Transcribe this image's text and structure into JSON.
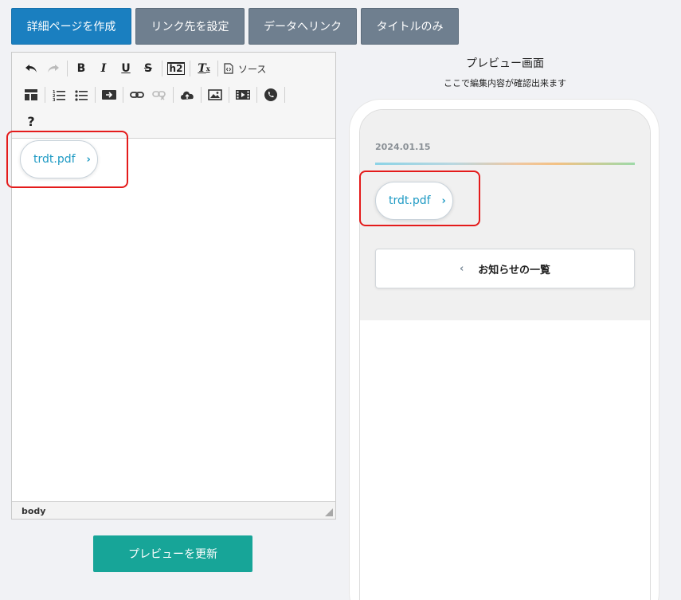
{
  "tabs": [
    {
      "label": "詳細ページを作成",
      "active": true
    },
    {
      "label": "リンク先を設定",
      "active": false
    },
    {
      "label": "データへリンク",
      "active": false
    },
    {
      "label": "タイトルのみ",
      "active": false
    }
  ],
  "editor": {
    "toolbar": {
      "row1": [
        "undo-icon",
        "redo-icon",
        "bold-icon",
        "italic-icon",
        "underline-icon",
        "strikethrough-icon",
        "heading-h2-icon",
        "remove-format-icon",
        "source-icon"
      ],
      "bold": "B",
      "italic": "I",
      "underline": "U",
      "strike": "S",
      "h2": "h2",
      "clear_format": "T",
      "source_label": "ソース",
      "help": "?"
    },
    "content": {
      "pdf_link_label": "trdt.pdf"
    },
    "status_path": "body"
  },
  "update_button_label": "プレビューを更新",
  "preview": {
    "title": "プレビュー画面",
    "subtitle": "ここで編集内容が確認出来ます",
    "date": "2024.01.15",
    "pdf_link_label": "trdt.pdf",
    "notice_list_label": "お知らせの一覧"
  },
  "colors": {
    "active_tab": "#1a7fc0",
    "inactive_tab": "#6f7f8f",
    "update_button": "#17a598",
    "link": "#1e9ac4",
    "highlight": "#e41b1b"
  }
}
